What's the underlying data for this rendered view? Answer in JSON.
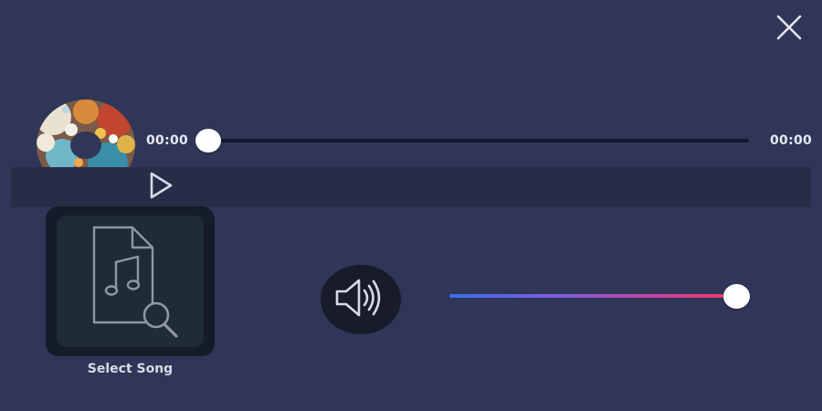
{
  "player": {
    "current_time": "00:00",
    "total_time": "00:00",
    "progress_fraction": 0
  },
  "select_song": {
    "label": "Select Song"
  },
  "volume": {
    "level_fraction": 1.0
  },
  "icons": {
    "close": "close-icon",
    "play": "play-icon",
    "music_file_search": "music-file-search-icon",
    "speaker": "speaker-volume-icon",
    "album_art": "album-art-disc"
  },
  "colors": {
    "background": "#2f3657",
    "control_bar": "#282d47",
    "card_outer": "#161b29",
    "card_inner": "#1f2b37",
    "volume_gradient_start": "#3b6cf0",
    "volume_gradient_end": "#f03d6e"
  }
}
